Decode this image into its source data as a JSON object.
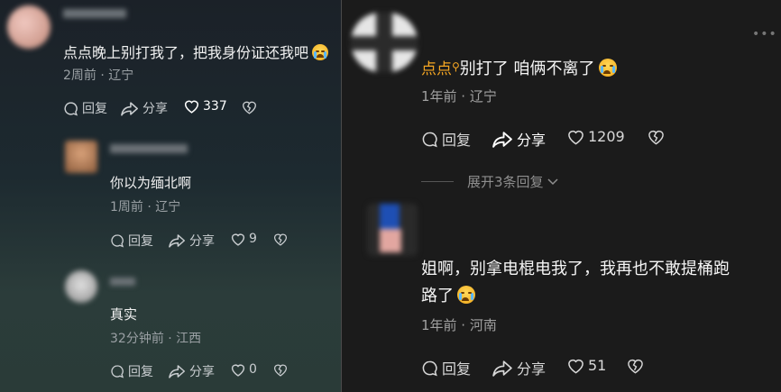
{
  "left": {
    "comments": [
      {
        "text": "点点晚上别打我了，把我身份证还我吧",
        "meta": "2周前 · 辽宁",
        "reply": "回复",
        "share": "分享",
        "likes": "337"
      },
      {
        "text": "你以为缅北啊",
        "meta": "1周前 · 辽宁",
        "reply": "回复",
        "share": "分享",
        "likes": "9"
      },
      {
        "text": "真实",
        "meta": "32分钟前 · 江西",
        "reply": "回复",
        "share": "分享",
        "likes": "0"
      }
    ]
  },
  "right": {
    "comments": [
      {
        "username": "点点",
        "text": "别打了  咱俩不离了",
        "meta": "1年前 · 辽宁",
        "reply": "回复",
        "share": "分享",
        "likes": "1209"
      },
      {
        "text_line1": "姐啊，别拿电棍电我了，我再也不敢提桶跑",
        "text_line2": "路了",
        "meta": "1年前 · 河南",
        "reply": "回复",
        "share": "分享",
        "likes": "51"
      }
    ],
    "expand_replies": "展开3条回复"
  },
  "colors": {
    "accent_username": "#f5a623",
    "left_bg": "#1d2a30",
    "right_bg": "#1b1b1b"
  }
}
